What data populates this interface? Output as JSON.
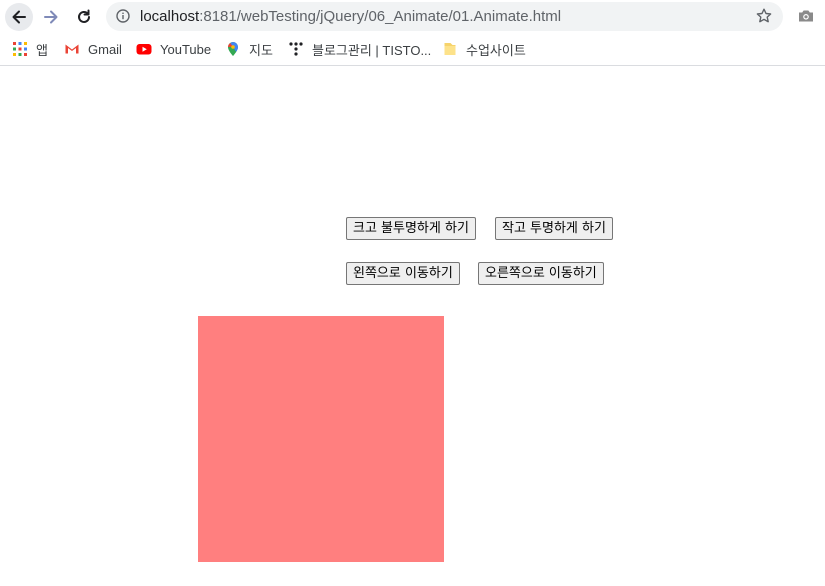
{
  "browser": {
    "url_host": "localhost",
    "url_rest": ":8181/webTesting/jQuery/06_Animate/01.Animate.html"
  },
  "bookmarks": [
    {
      "label": "앱",
      "icon": "apps-grid-icon"
    },
    {
      "label": "Gmail",
      "icon": "gmail-icon"
    },
    {
      "label": "YouTube",
      "icon": "youtube-icon"
    },
    {
      "label": "지도",
      "icon": "maps-pin-icon"
    },
    {
      "label": "블로그관리 | TISTO...",
      "icon": "tistory-icon"
    },
    {
      "label": "수업사이트",
      "icon": "folder-icon"
    }
  ],
  "page": {
    "btn_grow_opaque": "크고 불투명하게 하기",
    "btn_shrink_transparent": "작고 투명하게 하기",
    "btn_move_left": "왼쪽으로 이동하기",
    "btn_move_right": "오른쪽으로 이동하기"
  },
  "colors": {
    "box": "#ff7f7f",
    "accent_blue": "#1a73e8"
  }
}
